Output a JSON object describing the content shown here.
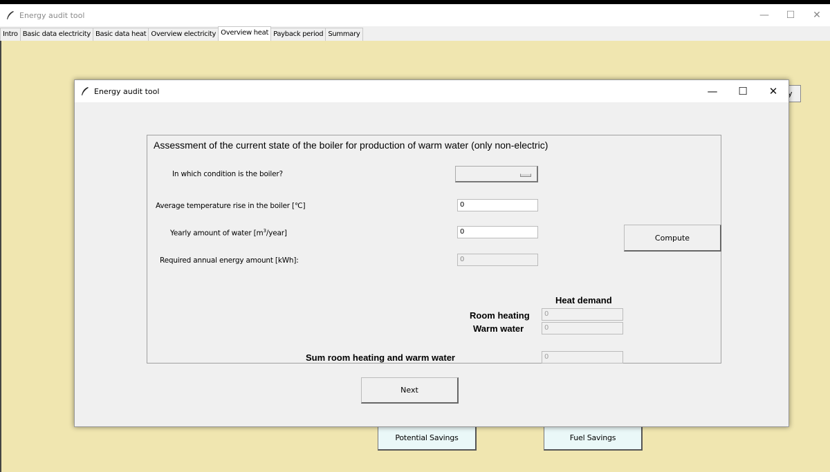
{
  "main_window": {
    "title": "Energy audit tool",
    "controls": {
      "minimize": "—",
      "maximize": "☐",
      "close": "✕"
    }
  },
  "tabs": [
    {
      "label": "Intro",
      "active": false
    },
    {
      "label": "Basic data electricity",
      "active": false
    },
    {
      "label": "Basic data heat",
      "active": false
    },
    {
      "label": "Overview electricity",
      "active": false
    },
    {
      "label": "Overview heat",
      "active": true
    },
    {
      "label": "Payback period",
      "active": false
    },
    {
      "label": "Summary",
      "active": false
    }
  ],
  "background": {
    "partial_button_label": "y",
    "potential_savings_label": "Potential Savings",
    "fuel_savings_label": "Fuel Savings",
    "app_color": "#f0e6b0",
    "button_color": "#eaf8f8"
  },
  "dialog": {
    "title": "Energy audit tool",
    "controls": {
      "minimize": "—",
      "maximize": "☐",
      "close": "✕"
    },
    "frame_title": "Assessment of the current state of the boiler for production of warm water (only non-electric)",
    "condition_label": "In which condition is the boiler?",
    "condition_value": "",
    "temp_rise_label": "Average temperature rise in the boiler [℃]",
    "temp_rise_value": "0",
    "water_label_prefix": "Yearly amount of water [m",
    "water_label_sup": "3",
    "water_label_suffix": "/year]",
    "water_value": "0",
    "energy_label": "Required annual energy amount [kWh]:",
    "energy_value": "0",
    "compute_label": "Compute",
    "heat_demand_header": "Heat demand",
    "room_heating_label": "Room heating",
    "room_heating_value": "0",
    "warm_water_label": "Warm water",
    "warm_water_value": "0",
    "sum_label": "Sum room heating and warm water",
    "sum_value": "0",
    "next_label": "Next"
  }
}
